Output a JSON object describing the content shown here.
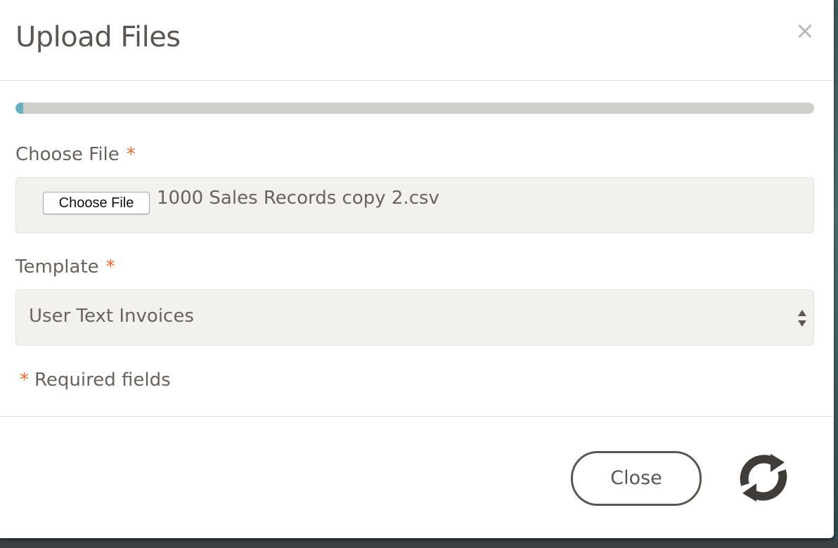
{
  "dialog": {
    "title": "Upload Files",
    "close_icon": "×"
  },
  "progress": {
    "percent": 1,
    "color": "#6aaec2"
  },
  "file_field": {
    "label": "Choose File",
    "required_marker": "*",
    "button_label": "Choose File",
    "file_name": "1000 Sales Records copy 2.csv"
  },
  "template_field": {
    "label": "Template",
    "required_marker": "*",
    "selected": "User Text Invoices"
  },
  "required_note": {
    "marker": "*",
    "text": "Required fields"
  },
  "footer": {
    "close_label": "Close",
    "refresh_icon": "refresh-icon"
  },
  "colors": {
    "accent": "#e06a30",
    "text": "#5c5652"
  }
}
